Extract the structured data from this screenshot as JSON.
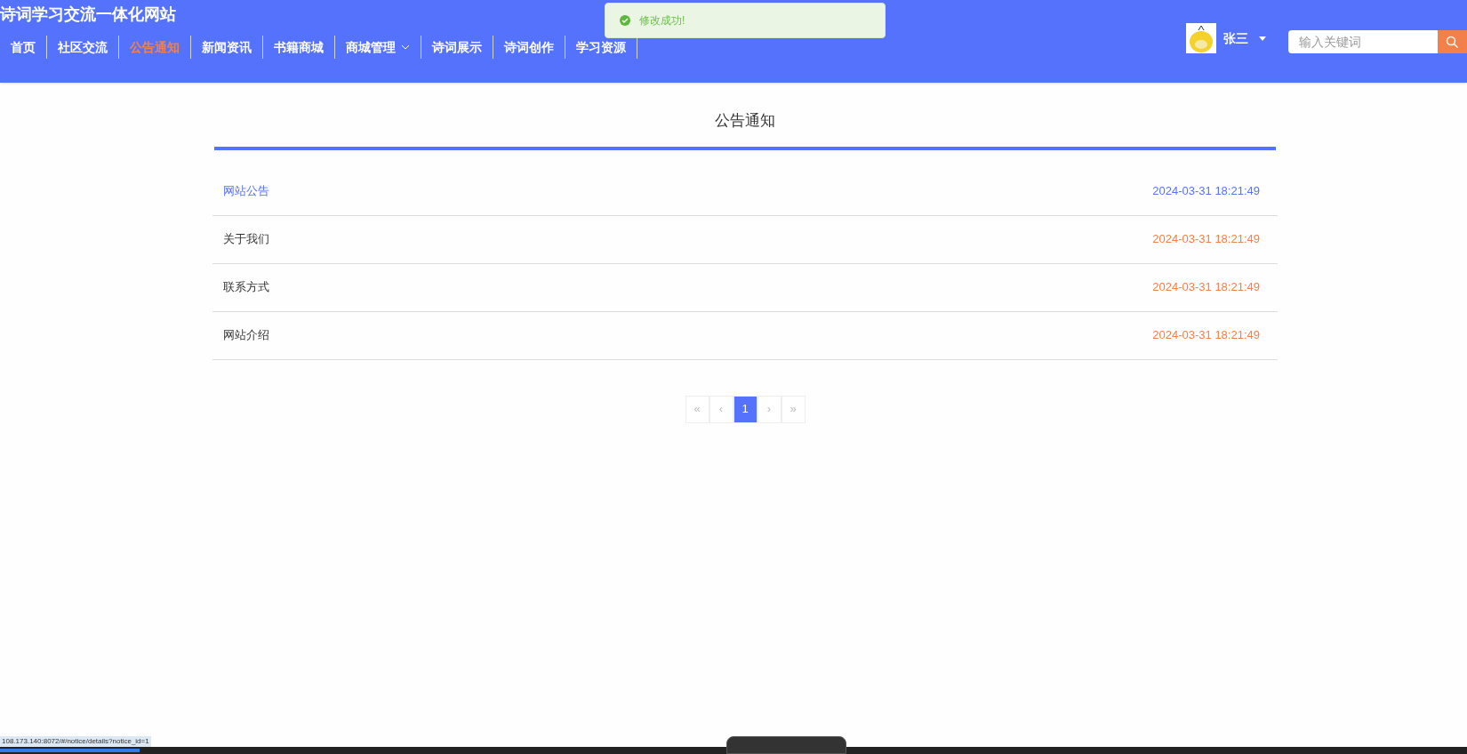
{
  "site_title": "诗词学习交流一体化网站",
  "nav": [
    {
      "label": "首页",
      "selected": false,
      "dropdown": false
    },
    {
      "label": "社区交流",
      "selected": false,
      "dropdown": false
    },
    {
      "label": "公告通知",
      "selected": true,
      "dropdown": false
    },
    {
      "label": "新闻资讯",
      "selected": false,
      "dropdown": false
    },
    {
      "label": "书籍商城",
      "selected": false,
      "dropdown": false
    },
    {
      "label": "商城管理",
      "selected": false,
      "dropdown": true
    },
    {
      "label": "诗词展示",
      "selected": false,
      "dropdown": false
    },
    {
      "label": "诗词创作",
      "selected": false,
      "dropdown": false
    },
    {
      "label": "学习资源",
      "selected": false,
      "dropdown": false
    }
  ],
  "toast": {
    "message": "修改成功!"
  },
  "user": {
    "name": "张三"
  },
  "search": {
    "placeholder": "输入关键词"
  },
  "page_title": "公告通知",
  "notices": [
    {
      "title": "网站公告",
      "time": "2024-03-31 18:21:49",
      "hovered": true
    },
    {
      "title": "关于我们",
      "time": "2024-03-31 18:21:49",
      "hovered": false
    },
    {
      "title": "联系方式",
      "time": "2024-03-31 18:21:49",
      "hovered": false
    },
    {
      "title": "网站介绍",
      "time": "2024-03-31 18:21:49",
      "hovered": false
    }
  ],
  "pagination": [
    {
      "label": "«",
      "selected": false
    },
    {
      "label": "‹",
      "selected": false
    },
    {
      "label": "1",
      "selected": true
    },
    {
      "label": "›",
      "selected": false
    },
    {
      "label": "»",
      "selected": false
    }
  ],
  "player": {
    "level": 0.095
  },
  "status_url": "108.173.140:8072/#/notice/details?notice_id=1"
}
